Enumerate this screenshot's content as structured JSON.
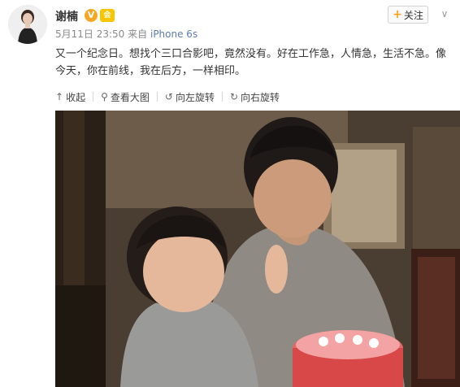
{
  "post": {
    "author": "谢楠",
    "badges": {
      "verified": "V",
      "vip": "会"
    },
    "time": "5月11日 23:50",
    "source_prefix": "来自",
    "source": "iPhone 6s",
    "follow_label": "关注",
    "text": "又一个纪念日。想找个三口合影吧，竟然没有。好在工作急，人情急，生活不急。像今天，你在前线，我在后方，一样相印。"
  },
  "toolbar": {
    "collapse": "收起",
    "view_large": "查看大图",
    "rotate_left": "向左旋转",
    "rotate_right": "向右旋转"
  },
  "colors": {
    "accent": "#f7a21c",
    "link": "#5d7cab",
    "meta_gray": "#8a8a8a"
  },
  "icons": {
    "collapse": "arrow-up-icon",
    "view_large": "magnifier-icon",
    "rotate_left": "rotate-left-icon",
    "rotate_right": "rotate-right-icon"
  }
}
